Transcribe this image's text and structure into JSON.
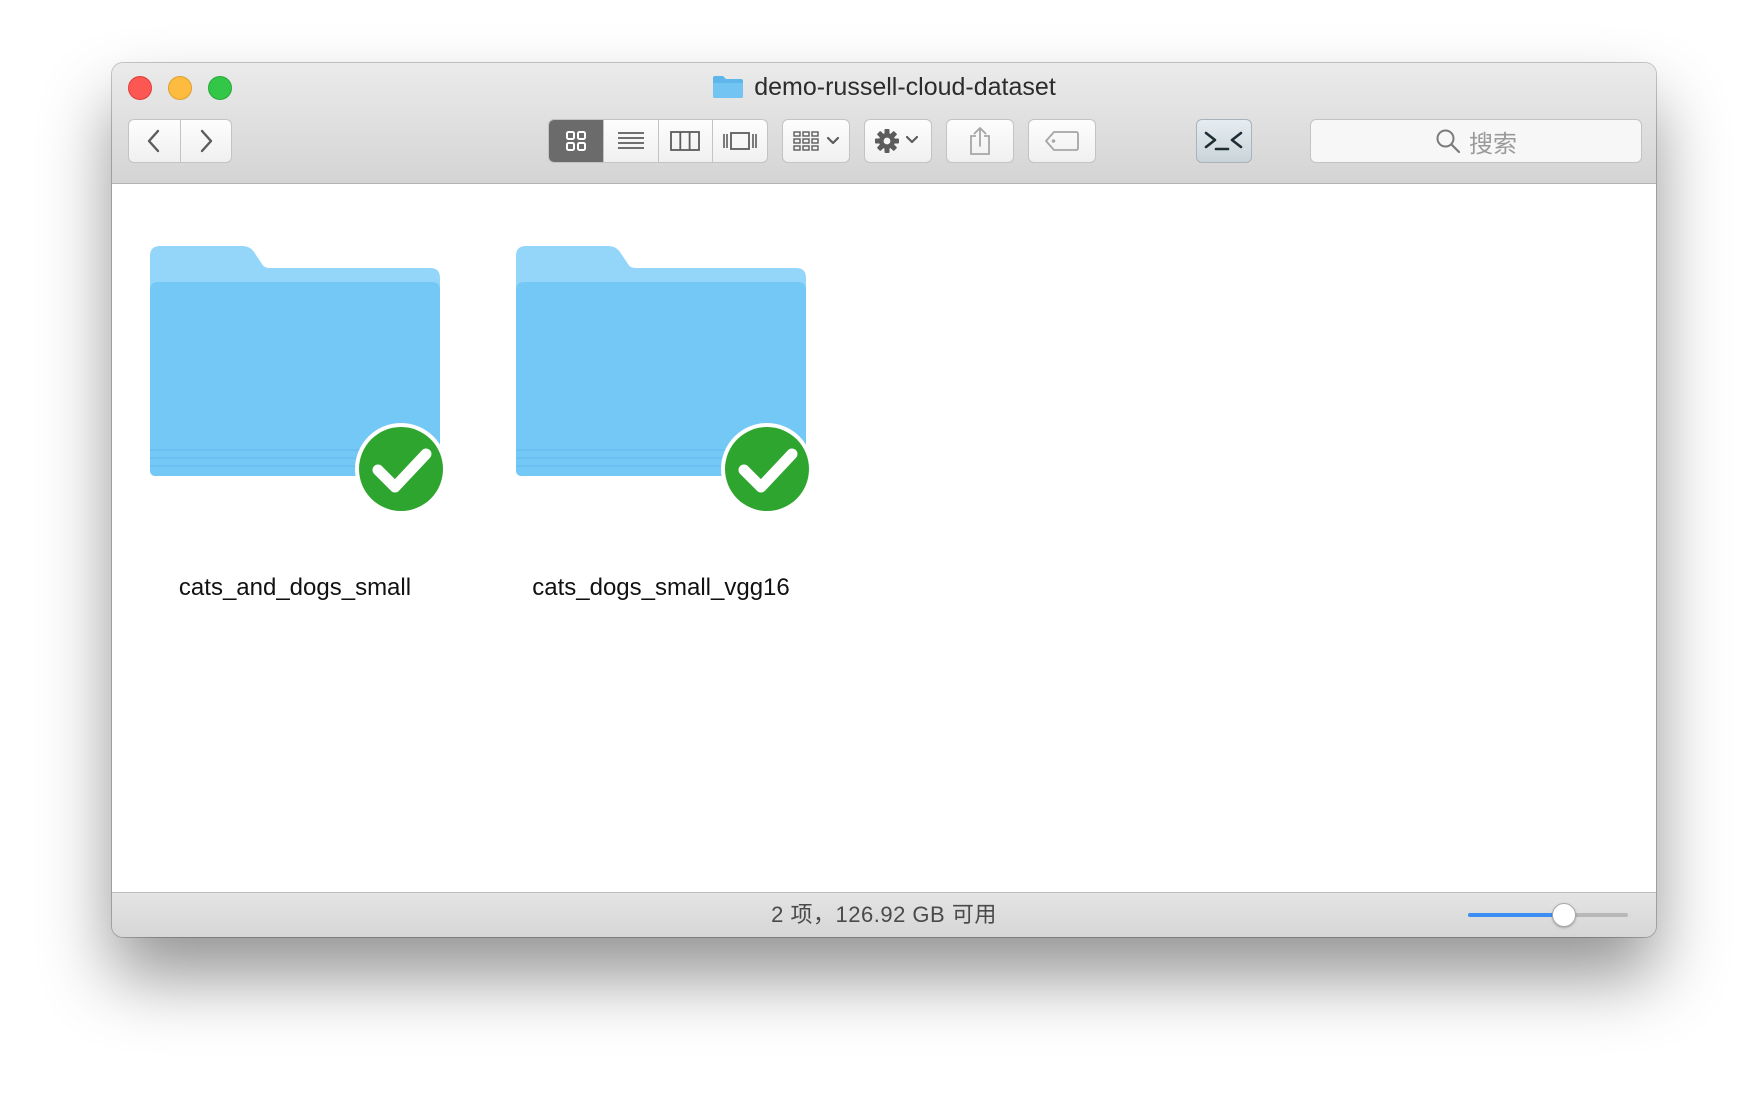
{
  "window": {
    "title": "demo-russell-cloud-dataset",
    "title_icon": "folder-icon"
  },
  "toolbar": {
    "back_icon": "chevron-left-icon",
    "forward_icon": "chevron-right-icon",
    "view_modes": [
      {
        "name": "icon-view",
        "icon": "grid-icon",
        "active": true
      },
      {
        "name": "list-view",
        "icon": "list-icon",
        "active": false
      },
      {
        "name": "column-view",
        "icon": "columns-icon",
        "active": false
      },
      {
        "name": "gallery-view",
        "icon": "cover-flow-icon",
        "active": false
      }
    ],
    "arrange_icon": "arrange-icon",
    "action_icon": "gear-icon",
    "share_icon": "share-icon",
    "tag_icon": "tag-icon",
    "terminal_icon": "terminal-icon",
    "search_placeholder": "搜索"
  },
  "files": [
    {
      "name": "cats_and_dogs_small",
      "type": "folder",
      "sync_status": "synced"
    },
    {
      "name": "cats_dogs_small_vgg16",
      "type": "folder",
      "sync_status": "synced"
    }
  ],
  "statusbar": {
    "text": "2 项，126.92 GB 可用",
    "icon_size_fraction": 0.6
  },
  "colors": {
    "accent": "#3b8ff3",
    "folder_back": "#8fd1f8",
    "folder_front": "#6cc5f4",
    "check_green": "#2ca02c"
  }
}
